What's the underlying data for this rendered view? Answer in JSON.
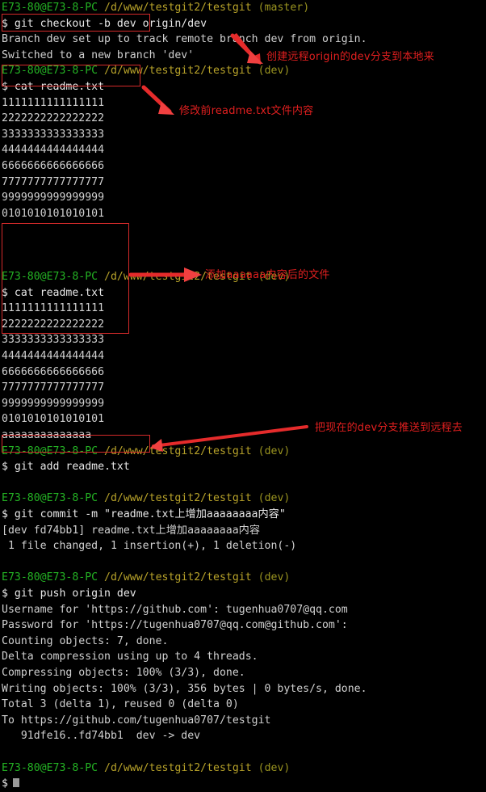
{
  "terminal": {
    "window_size": "602x730",
    "background": "#000000",
    "colors": {
      "host": "#24b324",
      "path": "#b8a32a",
      "branch": "#9a9420",
      "output": "#d0d0d0",
      "annotation": "#e01f1f"
    },
    "prompt": {
      "host": "E73-80@E73-8-PC",
      "path": "/d/www/testgit2/testgit",
      "branch_master": "(master)",
      "branch_dev": "(dev)",
      "symbol": "$"
    },
    "lines": [
      {
        "type": "prompt",
        "host": "E73-80@E73-8-PC",
        "path": "/d/www/testgit2/testgit",
        "branch": "(master)"
      },
      {
        "type": "cmd",
        "text": "$ git checkout -b dev origin/dev"
      },
      {
        "type": "out",
        "text": "Branch dev set up to track remote branch dev from origin."
      },
      {
        "type": "out",
        "text": "Switched to a new branch 'dev'"
      },
      {
        "type": "prompt",
        "host": "E73-80@E73-8-PC",
        "path": "/d/www/testgit2/testgit",
        "branch": "(dev)"
      },
      {
        "type": "cmd",
        "text": "$ cat readme.txt"
      },
      {
        "type": "out",
        "text": "1111111111111111"
      },
      {
        "type": "out",
        "text": "2222222222222222"
      },
      {
        "type": "out",
        "text": "3333333333333333"
      },
      {
        "type": "out",
        "text": "4444444444444444"
      },
      {
        "type": "out",
        "text": "6666666666666666"
      },
      {
        "type": "out",
        "text": "7777777777777777"
      },
      {
        "type": "out",
        "text": "9999999999999999"
      },
      {
        "type": "out",
        "text": "0101010101010101"
      },
      {
        "type": "blank",
        "text": ""
      },
      {
        "type": "blank",
        "text": ""
      },
      {
        "type": "blank",
        "text": ""
      },
      {
        "type": "prompt",
        "host": "E73-80@E73-8-PC",
        "path": "/d/www/testgit2/testgit",
        "branch": "(dev)"
      },
      {
        "type": "cmd",
        "text": "$ cat readme.txt"
      },
      {
        "type": "out",
        "text": "1111111111111111"
      },
      {
        "type": "out",
        "text": "2222222222222222"
      },
      {
        "type": "out",
        "text": "3333333333333333"
      },
      {
        "type": "out",
        "text": "4444444444444444"
      },
      {
        "type": "out",
        "text": "6666666666666666"
      },
      {
        "type": "out",
        "text": "7777777777777777"
      },
      {
        "type": "out",
        "text": "9999999999999999"
      },
      {
        "type": "out",
        "text": "0101010101010101"
      },
      {
        "type": "out",
        "text": "aaaaaaaaaaaaaa"
      },
      {
        "type": "prompt",
        "host": "E73-80@E73-8-PC",
        "path": "/d/www/testgit2/testgit",
        "branch": "(dev)"
      },
      {
        "type": "cmd",
        "text": "$ git add readme.txt"
      },
      {
        "type": "blank",
        "text": ""
      },
      {
        "type": "prompt",
        "host": "E73-80@E73-8-PC",
        "path": "/d/www/testgit2/testgit",
        "branch": "(dev)"
      },
      {
        "type": "cmd",
        "text": "$ git commit -m \"readme.txt上增加aaaaaaaa内容\""
      },
      {
        "type": "out",
        "text": "[dev fd74bb1] readme.txt上增加aaaaaaaa内容"
      },
      {
        "type": "out",
        "text": " 1 file changed, 1 insertion(+), 1 deletion(-)"
      },
      {
        "type": "blank",
        "text": ""
      },
      {
        "type": "prompt",
        "host": "E73-80@E73-8-PC",
        "path": "/d/www/testgit2/testgit",
        "branch": "(dev)"
      },
      {
        "type": "cmd",
        "text": "$ git push origin dev"
      },
      {
        "type": "out",
        "text": "Username for 'https://github.com': tugenhua0707@qq.com"
      },
      {
        "type": "out",
        "text": "Password for 'https://tugenhua0707@qq.com@github.com':"
      },
      {
        "type": "out",
        "text": "Counting objects: 7, done."
      },
      {
        "type": "out",
        "text": "Delta compression using up to 4 threads."
      },
      {
        "type": "out",
        "text": "Compressing objects: 100% (3/3), done."
      },
      {
        "type": "out",
        "text": "Writing objects: 100% (3/3), 356 bytes | 0 bytes/s, done."
      },
      {
        "type": "out",
        "text": "Total 3 (delta 1), reused 0 (delta 0)"
      },
      {
        "type": "out",
        "text": "To https://github.com/tugenhua0707/testgit"
      },
      {
        "type": "out",
        "text": "   91dfe16..fd74bb1  dev -> dev"
      },
      {
        "type": "blank",
        "text": ""
      },
      {
        "type": "prompt",
        "host": "E73-80@E73-8-PC",
        "path": "/d/www/testgit2/testgit",
        "branch": "(dev)"
      },
      {
        "type": "cursor",
        "text": "$"
      }
    ]
  },
  "annotations": {
    "notes": [
      {
        "id": "note-1",
        "text": "创建远程origin的dev分支到本地来"
      },
      {
        "id": "note-2",
        "text": "修改前readme.txt文件内容"
      },
      {
        "id": "note-3",
        "text": "添加aaaaaa内容后的文件"
      },
      {
        "id": "note-4",
        "text": "把现在的dev分支推送到远程去"
      }
    ]
  }
}
